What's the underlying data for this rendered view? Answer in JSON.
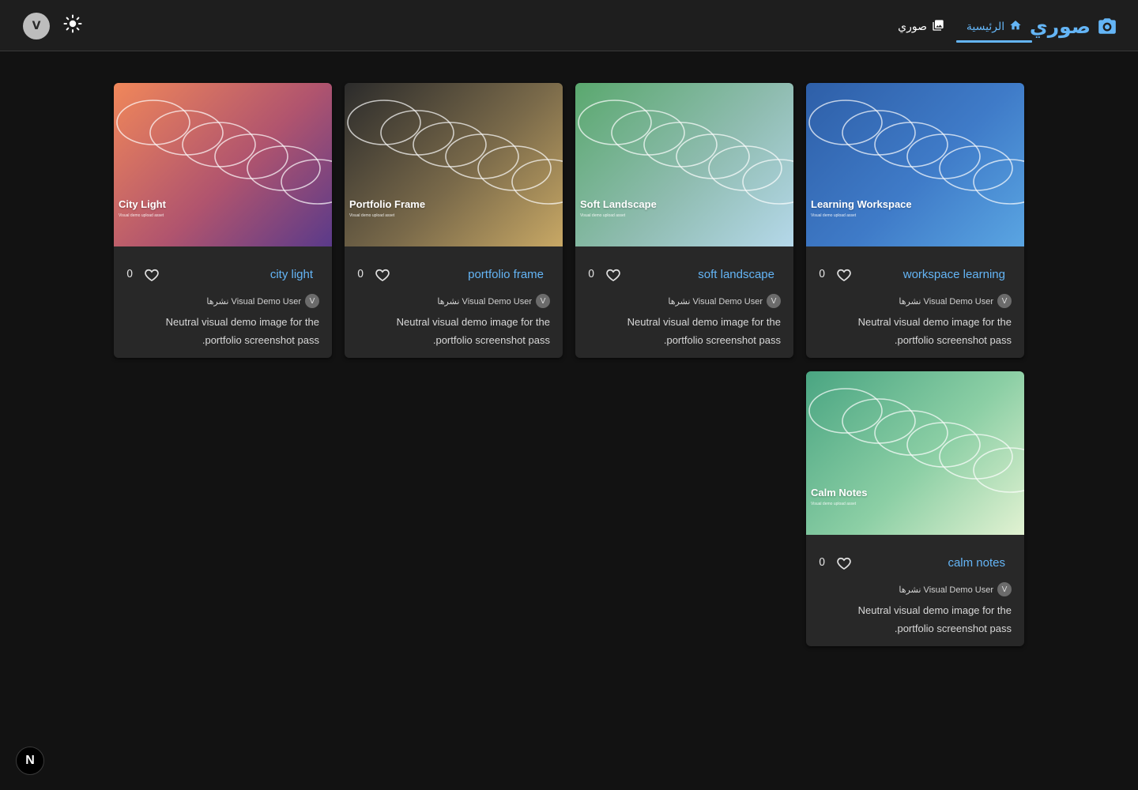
{
  "header": {
    "brand_title": "صوري",
    "nav": {
      "home_label": "الرئيسية",
      "my_photos_label": "صوري"
    },
    "user_avatar_initial": "V",
    "theme_icon": "sun-icon"
  },
  "colors": {
    "accent": "#64b5f6",
    "background": "#121212",
    "card": "#282828",
    "header": "#1e1e1e"
  },
  "cards": [
    {
      "thumb_title": "City Light",
      "thumb_sub": "Visual demo upload asset",
      "title": "city light",
      "likes": "0",
      "author_initial": "V",
      "author_text": "نشرها Visual Demo User",
      "description": "Neutral visual demo image for the portfolio screenshot pass.",
      "gradient": [
        "#f0875a",
        "#b0546e",
        "#5a3a8a"
      ]
    },
    {
      "thumb_title": "Portfolio Frame",
      "thumb_sub": "Visual demo upload asset",
      "title": "portfolio frame",
      "likes": "0",
      "author_initial": "V",
      "author_text": "نشرها Visual Demo User",
      "description": "Neutral visual demo image for the portfolio screenshot pass.",
      "gradient": [
        "#2b2b2b",
        "#7a6a4a",
        "#c8a865"
      ]
    },
    {
      "thumb_title": "Soft Landscape",
      "thumb_sub": "Visual demo upload asset",
      "title": "soft landscape",
      "likes": "0",
      "author_initial": "V",
      "author_text": "نشرها Visual Demo User",
      "description": "Neutral visual demo image for the portfolio screenshot pass.",
      "gradient": [
        "#5aa86e",
        "#8fbcb0",
        "#b5d8ea"
      ]
    },
    {
      "thumb_title": "Learning Workspace",
      "thumb_sub": "Visual demo upload asset",
      "title": "workspace learning",
      "likes": "0",
      "author_initial": "V",
      "author_text": "نشرها Visual Demo User",
      "description": "Neutral visual demo image for the portfolio screenshot pass.",
      "gradient": [
        "#2e5fa8",
        "#3f7bc8",
        "#5aa5e2"
      ]
    },
    {
      "thumb_title": "Calm Notes",
      "thumb_sub": "Visual demo upload asset",
      "title": "calm notes",
      "likes": "0",
      "author_initial": "V",
      "author_text": "نشرها Visual Demo User",
      "description": "Neutral visual demo image for the portfolio screenshot pass.",
      "gradient": [
        "#4aa582",
        "#8ccfa5",
        "#e2f2d2"
      ]
    }
  ],
  "dev_badge": "N"
}
